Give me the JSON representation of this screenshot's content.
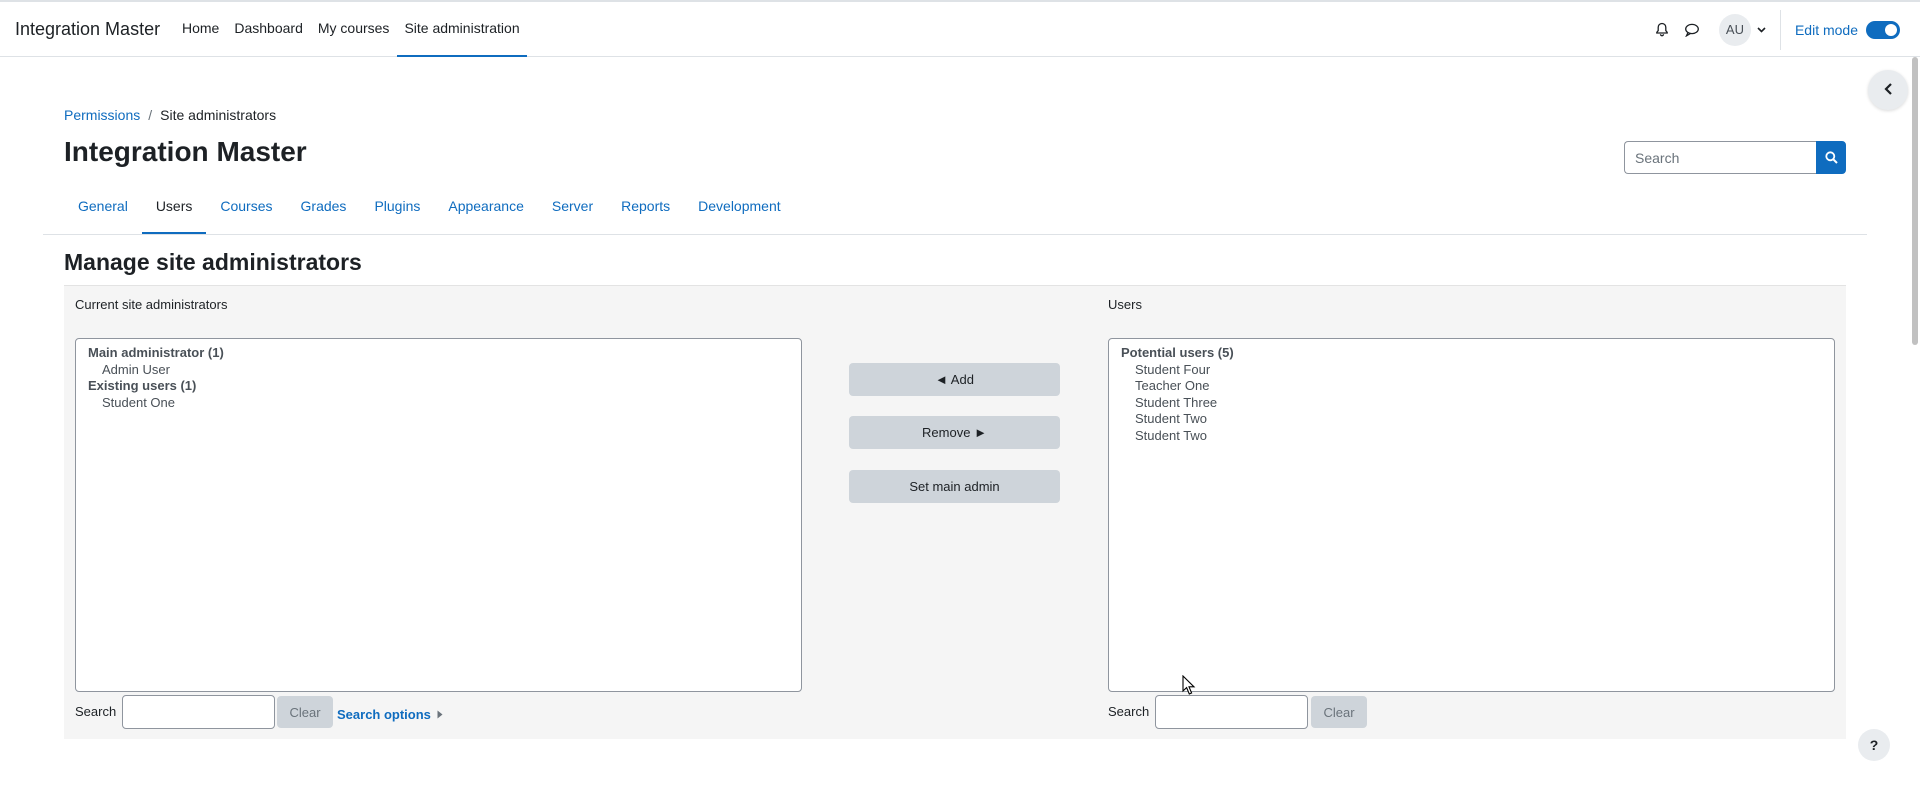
{
  "navbar": {
    "brand": "Integration Master",
    "nav_items": [
      "Home",
      "Dashboard",
      "My courses",
      "Site administration"
    ],
    "active_item": "Site administration",
    "avatar_initials": "AU",
    "edit_mode_label": "Edit mode",
    "edit_mode_on": true,
    "icons": [
      "bell-icon",
      "chat-icon",
      "chevron-down-icon"
    ]
  },
  "breadcrumb": {
    "items": [
      "Permissions",
      "Site administrators"
    ],
    "separator": "/"
  },
  "page": {
    "title": "Integration Master",
    "search_placeholder": "Search"
  },
  "tabs": {
    "items": [
      "General",
      "Users",
      "Courses",
      "Grades",
      "Plugins",
      "Appearance",
      "Server",
      "Reports",
      "Development"
    ],
    "active": "Users"
  },
  "main": {
    "heading": "Manage site administrators",
    "current": {
      "label": "Current site administrators",
      "groups": [
        {
          "label": "Main administrator (1)",
          "options": [
            "Admin User"
          ]
        },
        {
          "label": "Existing users (1)",
          "options": [
            "Student One"
          ]
        }
      ],
      "search_label": "Search",
      "clear_label": "Clear",
      "search_options_label": "Search options"
    },
    "actions": {
      "add": "◄ Add",
      "remove": "Remove ►",
      "set_main": "Set main admin"
    },
    "potential": {
      "label": "Users",
      "groups": [
        {
          "label": "Potential users (5)",
          "options": [
            "Student Four",
            "Teacher One",
            "Student Three",
            "Student Two",
            "Student Two"
          ]
        }
      ],
      "search_label": "Search",
      "clear_label": "Clear"
    }
  },
  "help_label": "?",
  "colors": {
    "accent": "#0f6cbf",
    "text": "#1d2125",
    "panel_bg": "#f5f5f5",
    "button_gray": "#ced4da"
  }
}
